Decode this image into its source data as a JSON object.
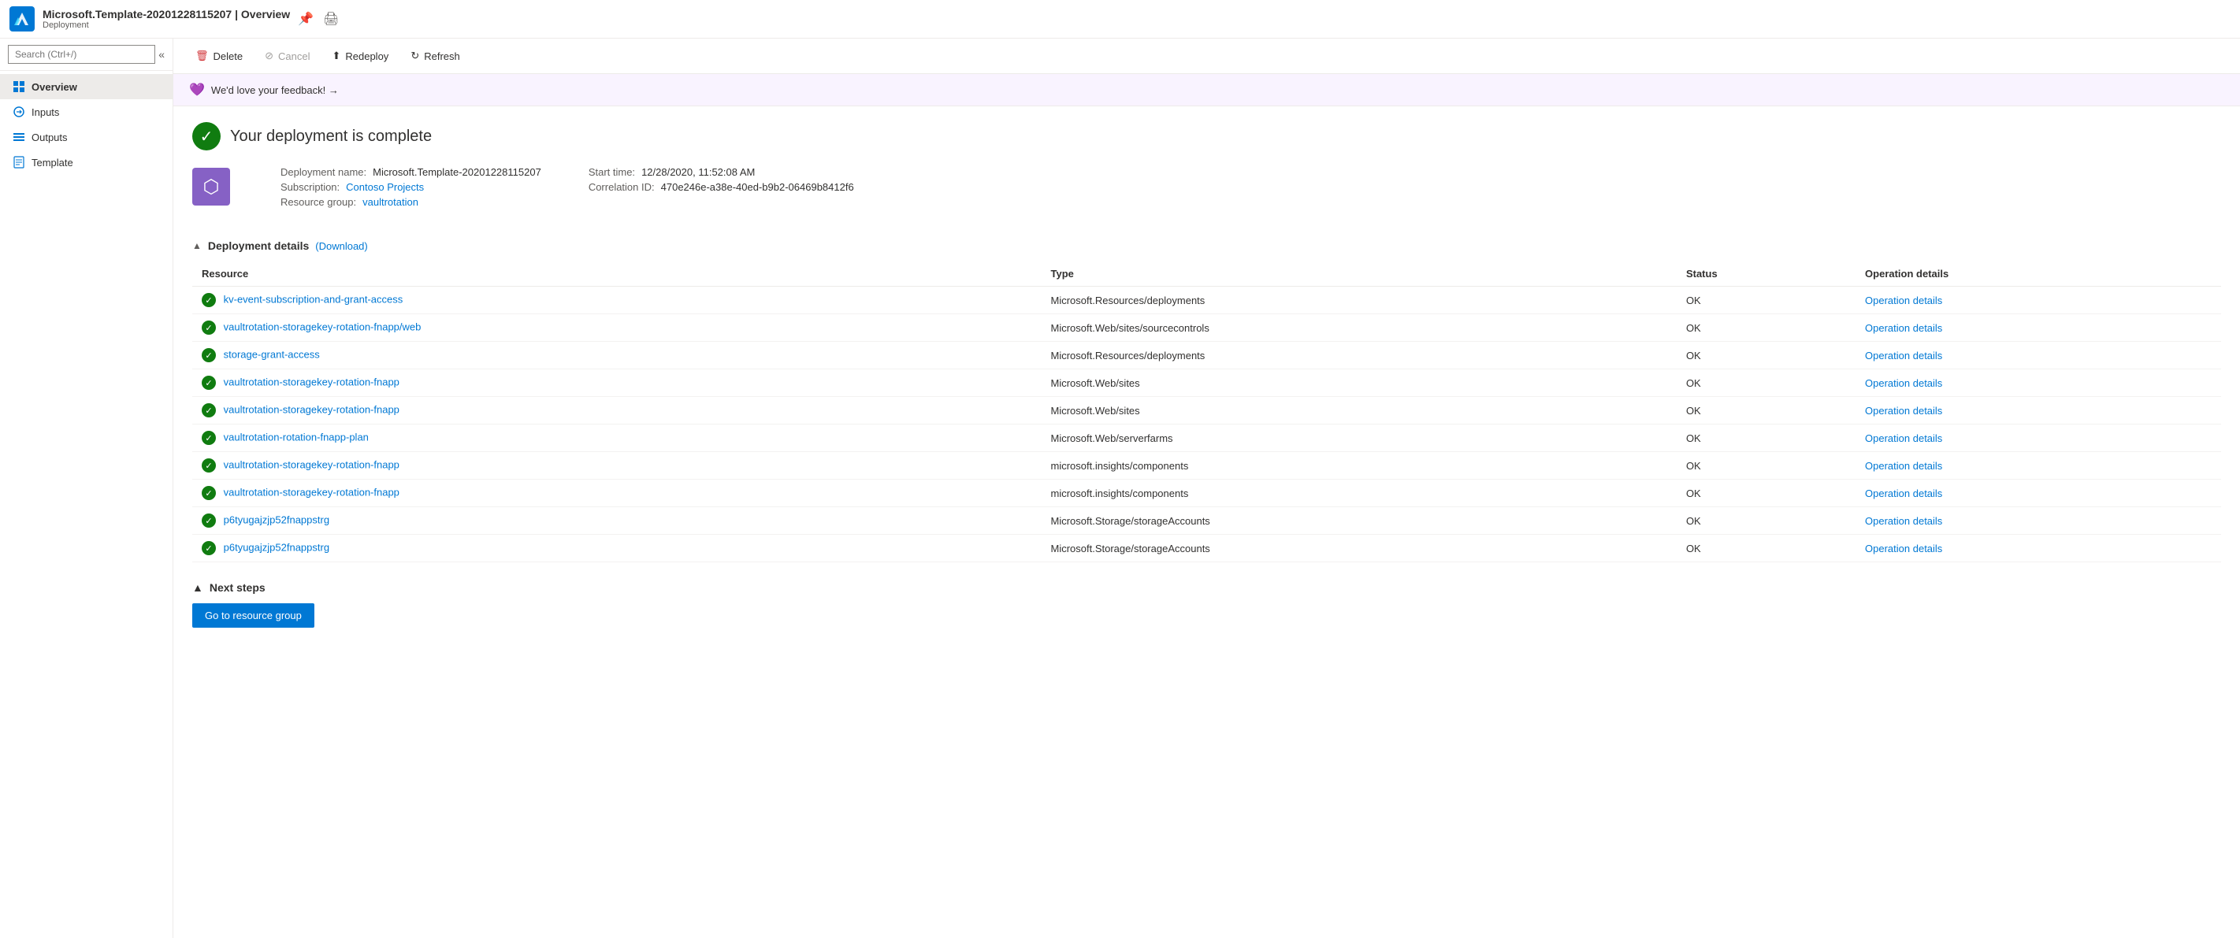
{
  "topbar": {
    "title": "Microsoft.Template-20201228115207 | Overview",
    "subtitle": "Deployment",
    "pin_icon": "📌",
    "print_icon": "🖨"
  },
  "sidebar": {
    "search_placeholder": "Search (Ctrl+/)",
    "items": [
      {
        "id": "overview",
        "label": "Overview",
        "active": true
      },
      {
        "id": "inputs",
        "label": "Inputs",
        "active": false
      },
      {
        "id": "outputs",
        "label": "Outputs",
        "active": false
      },
      {
        "id": "template",
        "label": "Template",
        "active": false
      }
    ]
  },
  "toolbar": {
    "delete_label": "Delete",
    "cancel_label": "Cancel",
    "redeploy_label": "Redeploy",
    "refresh_label": "Refresh"
  },
  "feedback": {
    "text": "We'd love your feedback! →"
  },
  "deployment": {
    "title": "Your deployment is complete",
    "name_label": "Deployment name:",
    "name_value": "Microsoft.Template-20201228115207",
    "subscription_label": "Subscription:",
    "subscription_value": "Contoso Projects",
    "resource_group_label": "Resource group:",
    "resource_group_value": "vaultrotation",
    "start_time_label": "Start time:",
    "start_time_value": "12/28/2020, 11:52:08 AM",
    "correlation_label": "Correlation ID:",
    "correlation_value": "470e246e-a38e-40ed-b9b2-06469b8412f6"
  },
  "deployment_details": {
    "section_title": "Deployment details",
    "download_label": "(Download)",
    "columns": [
      "Resource",
      "Type",
      "Status",
      "Operation details"
    ],
    "rows": [
      {
        "resource": "kv-event-subscription-and-grant-access",
        "type": "Microsoft.Resources/deployments",
        "status": "OK",
        "operation": "Operation details"
      },
      {
        "resource": "vaultrotation-storagekey-rotation-fnapp/web",
        "type": "Microsoft.Web/sites/sourcecontrols",
        "status": "OK",
        "operation": "Operation details"
      },
      {
        "resource": "storage-grant-access",
        "type": "Microsoft.Resources/deployments",
        "status": "OK",
        "operation": "Operation details"
      },
      {
        "resource": "vaultrotation-storagekey-rotation-fnapp",
        "type": "Microsoft.Web/sites",
        "status": "OK",
        "operation": "Operation details"
      },
      {
        "resource": "vaultrotation-storagekey-rotation-fnapp",
        "type": "Microsoft.Web/sites",
        "status": "OK",
        "operation": "Operation details"
      },
      {
        "resource": "vaultrotation-rotation-fnapp-plan",
        "type": "Microsoft.Web/serverfarms",
        "status": "OK",
        "operation": "Operation details"
      },
      {
        "resource": "vaultrotation-storagekey-rotation-fnapp",
        "type": "microsoft.insights/components",
        "status": "OK",
        "operation": "Operation details"
      },
      {
        "resource": "vaultrotation-storagekey-rotation-fnapp",
        "type": "microsoft.insights/components",
        "status": "OK",
        "operation": "Operation details"
      },
      {
        "resource": "p6tyugajzjp52fnappstrg",
        "type": "Microsoft.Storage/storageAccounts",
        "status": "OK",
        "operation": "Operation details"
      },
      {
        "resource": "p6tyugajzjp52fnappstrg",
        "type": "Microsoft.Storage/storageAccounts",
        "status": "OK",
        "operation": "Operation details"
      }
    ]
  },
  "next_steps": {
    "section_title": "Next steps",
    "go_to_resource_group_label": "Go to resource group"
  }
}
